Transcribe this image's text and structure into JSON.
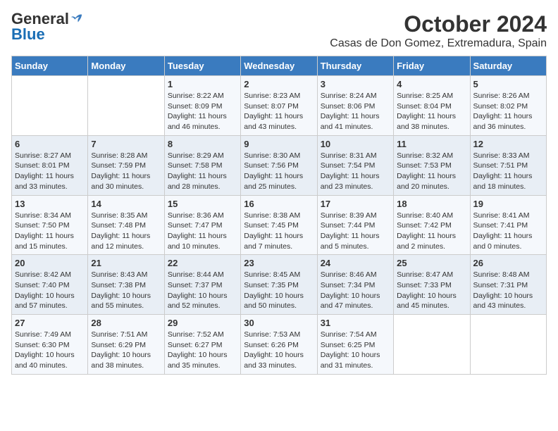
{
  "logo": {
    "general": "General",
    "blue": "Blue"
  },
  "title": "October 2024",
  "location": "Casas de Don Gomez, Extremadura, Spain",
  "days_of_week": [
    "Sunday",
    "Monday",
    "Tuesday",
    "Wednesday",
    "Thursday",
    "Friday",
    "Saturday"
  ],
  "weeks": [
    [
      {
        "day": null
      },
      {
        "day": null
      },
      {
        "day": 1,
        "sunrise": "Sunrise: 8:22 AM",
        "sunset": "Sunset: 8:09 PM",
        "daylight": "Daylight: 11 hours and 46 minutes."
      },
      {
        "day": 2,
        "sunrise": "Sunrise: 8:23 AM",
        "sunset": "Sunset: 8:07 PM",
        "daylight": "Daylight: 11 hours and 43 minutes."
      },
      {
        "day": 3,
        "sunrise": "Sunrise: 8:24 AM",
        "sunset": "Sunset: 8:06 PM",
        "daylight": "Daylight: 11 hours and 41 minutes."
      },
      {
        "day": 4,
        "sunrise": "Sunrise: 8:25 AM",
        "sunset": "Sunset: 8:04 PM",
        "daylight": "Daylight: 11 hours and 38 minutes."
      },
      {
        "day": 5,
        "sunrise": "Sunrise: 8:26 AM",
        "sunset": "Sunset: 8:02 PM",
        "daylight": "Daylight: 11 hours and 36 minutes."
      }
    ],
    [
      {
        "day": 6,
        "sunrise": "Sunrise: 8:27 AM",
        "sunset": "Sunset: 8:01 PM",
        "daylight": "Daylight: 11 hours and 33 minutes."
      },
      {
        "day": 7,
        "sunrise": "Sunrise: 8:28 AM",
        "sunset": "Sunset: 7:59 PM",
        "daylight": "Daylight: 11 hours and 30 minutes."
      },
      {
        "day": 8,
        "sunrise": "Sunrise: 8:29 AM",
        "sunset": "Sunset: 7:58 PM",
        "daylight": "Daylight: 11 hours and 28 minutes."
      },
      {
        "day": 9,
        "sunrise": "Sunrise: 8:30 AM",
        "sunset": "Sunset: 7:56 PM",
        "daylight": "Daylight: 11 hours and 25 minutes."
      },
      {
        "day": 10,
        "sunrise": "Sunrise: 8:31 AM",
        "sunset": "Sunset: 7:54 PM",
        "daylight": "Daylight: 11 hours and 23 minutes."
      },
      {
        "day": 11,
        "sunrise": "Sunrise: 8:32 AM",
        "sunset": "Sunset: 7:53 PM",
        "daylight": "Daylight: 11 hours and 20 minutes."
      },
      {
        "day": 12,
        "sunrise": "Sunrise: 8:33 AM",
        "sunset": "Sunset: 7:51 PM",
        "daylight": "Daylight: 11 hours and 18 minutes."
      }
    ],
    [
      {
        "day": 13,
        "sunrise": "Sunrise: 8:34 AM",
        "sunset": "Sunset: 7:50 PM",
        "daylight": "Daylight: 11 hours and 15 minutes."
      },
      {
        "day": 14,
        "sunrise": "Sunrise: 8:35 AM",
        "sunset": "Sunset: 7:48 PM",
        "daylight": "Daylight: 11 hours and 12 minutes."
      },
      {
        "day": 15,
        "sunrise": "Sunrise: 8:36 AM",
        "sunset": "Sunset: 7:47 PM",
        "daylight": "Daylight: 11 hours and 10 minutes."
      },
      {
        "day": 16,
        "sunrise": "Sunrise: 8:38 AM",
        "sunset": "Sunset: 7:45 PM",
        "daylight": "Daylight: 11 hours and 7 minutes."
      },
      {
        "day": 17,
        "sunrise": "Sunrise: 8:39 AM",
        "sunset": "Sunset: 7:44 PM",
        "daylight": "Daylight: 11 hours and 5 minutes."
      },
      {
        "day": 18,
        "sunrise": "Sunrise: 8:40 AM",
        "sunset": "Sunset: 7:42 PM",
        "daylight": "Daylight: 11 hours and 2 minutes."
      },
      {
        "day": 19,
        "sunrise": "Sunrise: 8:41 AM",
        "sunset": "Sunset: 7:41 PM",
        "daylight": "Daylight: 11 hours and 0 minutes."
      }
    ],
    [
      {
        "day": 20,
        "sunrise": "Sunrise: 8:42 AM",
        "sunset": "Sunset: 7:40 PM",
        "daylight": "Daylight: 10 hours and 57 minutes."
      },
      {
        "day": 21,
        "sunrise": "Sunrise: 8:43 AM",
        "sunset": "Sunset: 7:38 PM",
        "daylight": "Daylight: 10 hours and 55 minutes."
      },
      {
        "day": 22,
        "sunrise": "Sunrise: 8:44 AM",
        "sunset": "Sunset: 7:37 PM",
        "daylight": "Daylight: 10 hours and 52 minutes."
      },
      {
        "day": 23,
        "sunrise": "Sunrise: 8:45 AM",
        "sunset": "Sunset: 7:35 PM",
        "daylight": "Daylight: 10 hours and 50 minutes."
      },
      {
        "day": 24,
        "sunrise": "Sunrise: 8:46 AM",
        "sunset": "Sunset: 7:34 PM",
        "daylight": "Daylight: 10 hours and 47 minutes."
      },
      {
        "day": 25,
        "sunrise": "Sunrise: 8:47 AM",
        "sunset": "Sunset: 7:33 PM",
        "daylight": "Daylight: 10 hours and 45 minutes."
      },
      {
        "day": 26,
        "sunrise": "Sunrise: 8:48 AM",
        "sunset": "Sunset: 7:31 PM",
        "daylight": "Daylight: 10 hours and 43 minutes."
      }
    ],
    [
      {
        "day": 27,
        "sunrise": "Sunrise: 7:49 AM",
        "sunset": "Sunset: 6:30 PM",
        "daylight": "Daylight: 10 hours and 40 minutes."
      },
      {
        "day": 28,
        "sunrise": "Sunrise: 7:51 AM",
        "sunset": "Sunset: 6:29 PM",
        "daylight": "Daylight: 10 hours and 38 minutes."
      },
      {
        "day": 29,
        "sunrise": "Sunrise: 7:52 AM",
        "sunset": "Sunset: 6:27 PM",
        "daylight": "Daylight: 10 hours and 35 minutes."
      },
      {
        "day": 30,
        "sunrise": "Sunrise: 7:53 AM",
        "sunset": "Sunset: 6:26 PM",
        "daylight": "Daylight: 10 hours and 33 minutes."
      },
      {
        "day": 31,
        "sunrise": "Sunrise: 7:54 AM",
        "sunset": "Sunset: 6:25 PM",
        "daylight": "Daylight: 10 hours and 31 minutes."
      },
      {
        "day": null
      },
      {
        "day": null
      }
    ]
  ]
}
